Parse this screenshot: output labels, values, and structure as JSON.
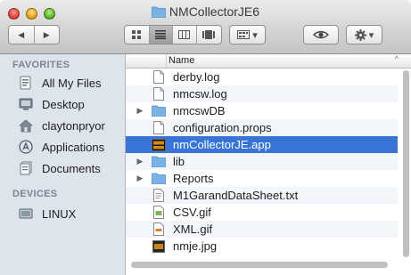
{
  "window": {
    "title": "NMCollectorJE6"
  },
  "toolbar": {
    "back_glyph": "◀",
    "forward_glyph": "▶",
    "views": [
      "icon-view",
      "list-view",
      "column-view",
      "coverflow-view"
    ],
    "arrange_caret": "▾",
    "action_caret": "▾"
  },
  "sidebar": {
    "favorites_heading": "FAVORITES",
    "favorites": [
      {
        "label": "All My Files",
        "icon": "all-files-icon"
      },
      {
        "label": "Desktop",
        "icon": "desktop-icon"
      },
      {
        "label": "claytonpryor",
        "icon": "home-icon"
      },
      {
        "label": "Applications",
        "icon": "applications-icon"
      },
      {
        "label": "Documents",
        "icon": "documents-icon"
      }
    ],
    "devices_heading": "DEVICES",
    "devices": [
      {
        "label": "LINUX",
        "icon": "drive-icon"
      }
    ]
  },
  "list": {
    "column_name": "Name",
    "sort_caret": "^",
    "rows": [
      {
        "name": "derby.log",
        "kind": "document",
        "expandable": false,
        "selected": false
      },
      {
        "name": "nmcsw.log",
        "kind": "document",
        "expandable": false,
        "selected": false
      },
      {
        "name": "nmcswDB",
        "kind": "folder",
        "expandable": true,
        "selected": false
      },
      {
        "name": "configuration.props",
        "kind": "document",
        "expandable": false,
        "selected": false
      },
      {
        "name": "nmCollectorJE.app",
        "kind": "app",
        "expandable": false,
        "selected": true
      },
      {
        "name": "lib",
        "kind": "folder",
        "expandable": true,
        "selected": false
      },
      {
        "name": "Reports",
        "kind": "folder",
        "expandable": true,
        "selected": false
      },
      {
        "name": "M1GarandDataSheet.txt",
        "kind": "text",
        "expandable": false,
        "selected": false
      },
      {
        "name": "CSV.gif",
        "kind": "image",
        "expandable": false,
        "selected": false
      },
      {
        "name": "XML.gif",
        "kind": "image",
        "expandable": false,
        "selected": false
      },
      {
        "name": "nmje.jpg",
        "kind": "image",
        "expandable": false,
        "selected": false
      }
    ]
  },
  "colors": {
    "selection": "#3875d7",
    "folder": "#7ab2e6",
    "sidebar_bg": "#dde4eb"
  }
}
